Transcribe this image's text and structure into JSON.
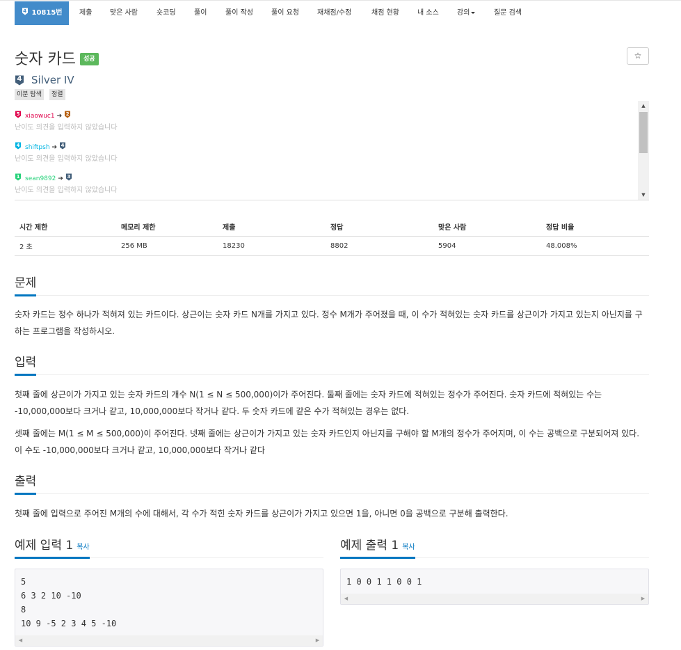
{
  "nav": {
    "problem_tab": {
      "tier_num": "4",
      "label": "10815번"
    },
    "tabs": [
      "제출",
      "맞은 사람",
      "숏코딩",
      "풀이",
      "풀이 작성",
      "풀이 요청",
      "재채점/수정",
      "채점 현황",
      "내 소스",
      "강의",
      "질문 검색"
    ]
  },
  "title": "숫자 카드",
  "status_badge": "성공",
  "star": "☆",
  "tier": {
    "num": "4",
    "text": "Silver IV"
  },
  "tags": [
    "이분 탐색",
    "정렬"
  ],
  "opinions": [
    {
      "user": "xiaowuc1",
      "user_tier": "5",
      "user_color": "#e0004a",
      "voted_tier": "2",
      "voted_color": "#b55f10",
      "note": "난이도 의견을 입력하지 않았습니다"
    },
    {
      "user": "shiftpsh",
      "user_tier": "4",
      "user_color": "#00b4e2",
      "voted_tier": "4",
      "voted_color": "#435f7a",
      "note": "난이도 의견을 입력하지 않았습니다"
    },
    {
      "user": "sean9892",
      "user_tier": "1",
      "user_color": "#26d27a",
      "voted_tier": "3",
      "voted_color": "#435f7a",
      "note": "난이도 의견을 입력하지 않았습니다"
    }
  ],
  "info": {
    "headers": [
      "시간 제한",
      "메모리 제한",
      "제출",
      "정답",
      "맞은 사람",
      "정답 비율"
    ],
    "values": [
      "2 초",
      "256 MB",
      "18230",
      "8802",
      "5904",
      "48.008%"
    ]
  },
  "sections": {
    "problem": {
      "title": "문제",
      "text": "숫자 카드는 정수 하나가 적혀져 있는 카드이다. 상근이는 숫자 카드 N개를 가지고 있다. 정수 M개가 주어졌을 때, 이 수가 적혀있는 숫자 카드를 상근이가 가지고 있는지 아닌지를 구하는 프로그램을 작성하시오."
    },
    "input": {
      "title": "입력",
      "text1": "첫째 줄에 상근이가 가지고 있는 숫자 카드의 개수 N(1 ≤ N ≤ 500,000)이가 주어진다. 둘째 줄에는 숫자 카드에 적혀있는 정수가 주어진다. 숫자 카드에 적혀있는 수는 -10,000,000보다 크거나 같고, 10,000,000보다 작거나 같다. 두 숫자 카드에 같은 수가 적혀있는 경우는 없다.",
      "text2": "셋째 줄에는 M(1 ≤ M ≤ 500,000)이 주어진다. 넷째 줄에는 상근이가 가지고 있는 숫자 카드인지 아닌지를 구해야 할 M개의 정수가 주어지며, 이 수는 공백으로 구분되어져 있다. 이 수도 -10,000,000보다 크거나 같고, 10,000,000보다 작거나 같다"
    },
    "output": {
      "title": "출력",
      "text": "첫째 줄에 입력으로 주어진 M개의 수에 대해서, 각 수가 적힌 숫자 카드를 상근이가 가지고 있으면 1을, 아니면 0을 공백으로 구분해 출력한다."
    }
  },
  "examples": {
    "input": {
      "title": "예제 입력 1",
      "copy": "복사",
      "content": "5\n6 3 2 10 -10\n8\n10 9 -5 2 3 4 5 -10"
    },
    "output": {
      "title": "예제 출력 1",
      "copy": "복사",
      "content": "1 0 0 1 1 0 0 1"
    }
  },
  "colors": {
    "accent": "#428bca",
    "success": "#5cb85c",
    "silver": "#435f7a",
    "section_underline": "#0076c0"
  }
}
